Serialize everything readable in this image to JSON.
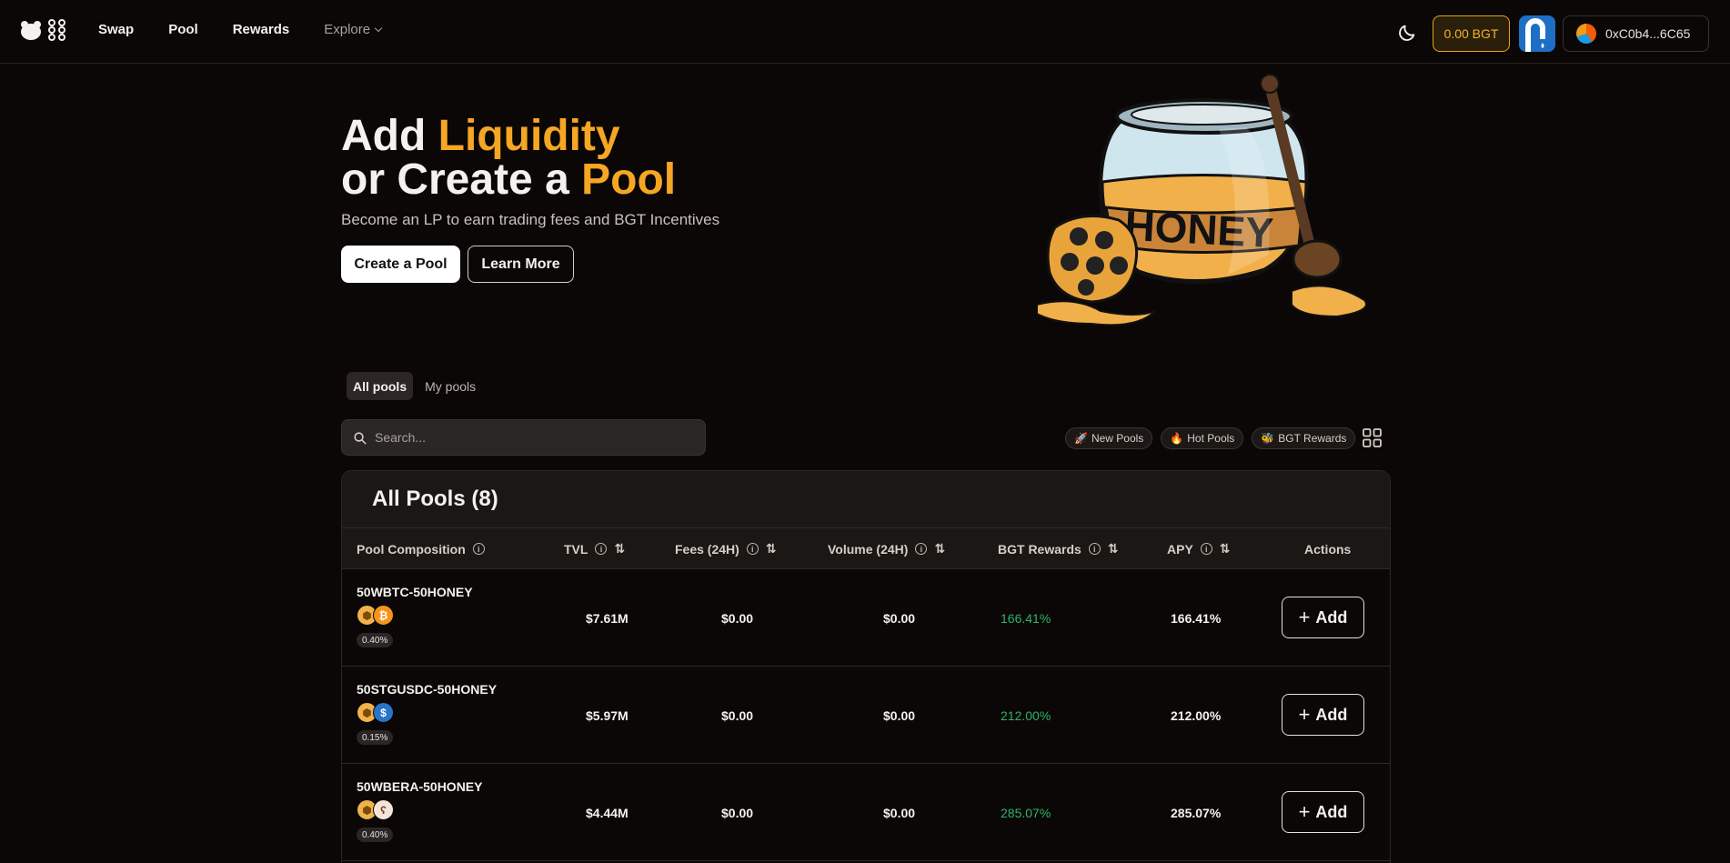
{
  "nav": {
    "items": [
      {
        "label": "Swap"
      },
      {
        "label": "Pool"
      },
      {
        "label": "Rewards"
      },
      {
        "label": "Explore"
      }
    ]
  },
  "header": {
    "bgt_balance": "0.00 BGT",
    "wallet_address": "0xC0b4...6C65"
  },
  "hero": {
    "title_line1_a": "Add ",
    "title_line1_b": "Liquidity",
    "title_line2_a": "or Create a ",
    "title_line2_b": "Pool",
    "subtitle": "Become an LP to earn trading fees and BGT Incentives",
    "create_label": "Create a Pool",
    "learn_label": "Learn More",
    "jar_text": "HONEY"
  },
  "tabs": [
    {
      "label": "All pools",
      "active": true
    },
    {
      "label": "My pools",
      "active": false
    }
  ],
  "search": {
    "placeholder": "Search..."
  },
  "filters": [
    {
      "icon": "🚀",
      "label": "New Pools"
    },
    {
      "icon": "🔥",
      "label": "Hot Pools"
    },
    {
      "icon": "🐝",
      "label": "BGT Rewards"
    }
  ],
  "table": {
    "title": "All Pools (8)",
    "columns": {
      "pool": "Pool Composition",
      "tvl": "TVL",
      "fees": "Fees (24H)",
      "volume": "Volume (24H)",
      "bgt": "BGT Rewards",
      "apy": "APY",
      "actions": "Actions"
    },
    "add_label": "Add",
    "rows": [
      {
        "name": "50WBTC-50HONEY",
        "fee": "0.40%",
        "tvl": "$7.61M",
        "fees": "$0.00",
        "volume": "$0.00",
        "bgt": "166.41%",
        "apy": "166.41%",
        "tokens": [
          "honey-token-icon",
          "btc-token-icon"
        ]
      },
      {
        "name": "50STGUSDC-50HONEY",
        "fee": "0.15%",
        "tvl": "$5.97M",
        "fees": "$0.00",
        "volume": "$0.00",
        "bgt": "212.00%",
        "apy": "212.00%",
        "tokens": [
          "honey-token-icon",
          "usdc-token-icon"
        ]
      },
      {
        "name": "50WBERA-50HONEY",
        "fee": "0.40%",
        "tvl": "$4.44M",
        "fees": "$0.00",
        "volume": "$0.00",
        "bgt": "285.07%",
        "apy": "285.07%",
        "tokens": [
          "honey-token-icon",
          "bera-token-icon"
        ]
      }
    ]
  },
  "colors": {
    "background": "#0b0706",
    "accent": "#f5a623",
    "positive": "#2fb36a"
  }
}
